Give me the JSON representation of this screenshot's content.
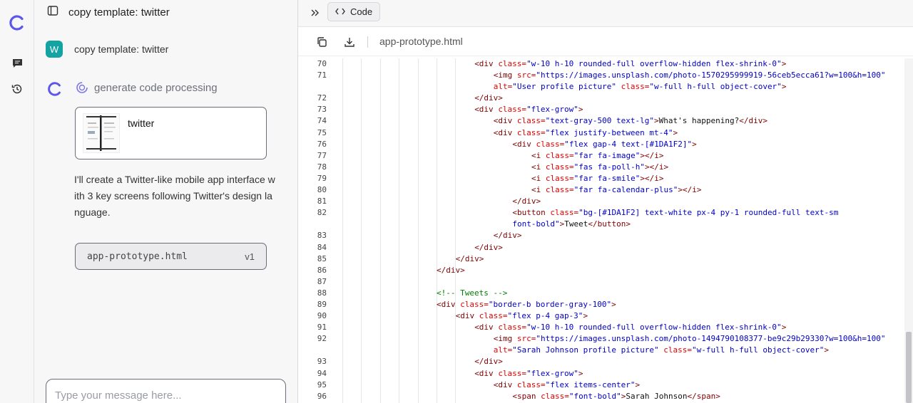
{
  "sidebar": {
    "icons": [
      "brand-logo-icon",
      "chat-icon",
      "history-icon"
    ]
  },
  "chat": {
    "header_title": "copy template: twitter",
    "user_avatar_letter": "W",
    "user_message": "copy template: twitter",
    "status_text": "generate code processing",
    "card_title": "twitter",
    "reply_text": "I'll create a Twitter-like mobile app interface with 3 key screens following Twitter's design language.",
    "file_chip": {
      "name": "app-prototype.html",
      "version": "v1"
    },
    "composer_placeholder": "Type your message here..."
  },
  "code_pane": {
    "tab_label": "Code",
    "filename": "app-prototype.html",
    "lines": [
      {
        "n": "70",
        "indent": 6,
        "html": "<span class=\"t-tag\">&lt;div</span> <span class=\"t-attr\">class=</span><span class=\"t-val\">\"w-10 h-10 rounded-full overflow-hidden flex-shrink-0\"</span><span class=\"t-tag\">&gt;</span>"
      },
      {
        "n": "71",
        "indent": 8,
        "html": "<span class=\"t-tag\">&lt;img</span> <span class=\"t-attr\">src=</span><span class=\"t-val\">\"https://images.unsplash.com/photo-1570295999919-56ceb5ecca61?w=100&amp;h=100\"</span>"
      },
      {
        "n": "",
        "indent": 8,
        "html": "<span class=\"t-attr\">alt=</span><span class=\"t-val\">\"User profile picture\"</span> <span class=\"t-attr\">class=</span><span class=\"t-val\">\"w-full h-full object-cover\"</span><span class=\"t-tag\">&gt;</span>"
      },
      {
        "n": "72",
        "indent": 6,
        "html": "<span class=\"t-tag\">&lt;/div&gt;</span>"
      },
      {
        "n": "73",
        "indent": 6,
        "html": "<span class=\"t-tag\">&lt;div</span> <span class=\"t-attr\">class=</span><span class=\"t-val\">\"flex-grow\"</span><span class=\"t-tag\">&gt;</span>"
      },
      {
        "n": "74",
        "indent": 8,
        "html": "<span class=\"t-tag\">&lt;div</span> <span class=\"t-attr\">class=</span><span class=\"t-val\">\"text-gray-500 text-lg\"</span><span class=\"t-tag\">&gt;</span><span class=\"t-text\">What's happening?</span><span class=\"t-tag\">&lt;/div&gt;</span>"
      },
      {
        "n": "75",
        "indent": 8,
        "html": "<span class=\"t-tag\">&lt;div</span> <span class=\"t-attr\">class=</span><span class=\"t-val\">\"flex justify-between mt-4\"</span><span class=\"t-tag\">&gt;</span>"
      },
      {
        "n": "76",
        "indent": 10,
        "html": "<span class=\"t-tag\">&lt;div</span> <span class=\"t-attr\">class=</span><span class=\"t-val\">\"flex gap-4 text-[#1DA1F2]\"</span><span class=\"t-tag\">&gt;</span>"
      },
      {
        "n": "77",
        "indent": 12,
        "html": "<span class=\"t-tag\">&lt;i</span> <span class=\"t-attr\">class=</span><span class=\"t-val\">\"far fa-image\"</span><span class=\"t-tag\">&gt;&lt;/i&gt;</span>"
      },
      {
        "n": "78",
        "indent": 12,
        "html": "<span class=\"t-tag\">&lt;i</span> <span class=\"t-attr\">class=</span><span class=\"t-val\">\"fas fa-poll-h\"</span><span class=\"t-tag\">&gt;&lt;/i&gt;</span>"
      },
      {
        "n": "79",
        "indent": 12,
        "html": "<span class=\"t-tag\">&lt;i</span> <span class=\"t-attr\">class=</span><span class=\"t-val\">\"far fa-smile\"</span><span class=\"t-tag\">&gt;&lt;/i&gt;</span>"
      },
      {
        "n": "80",
        "indent": 12,
        "html": "<span class=\"t-tag\">&lt;i</span> <span class=\"t-attr\">class=</span><span class=\"t-val\">\"far fa-calendar-plus\"</span><span class=\"t-tag\">&gt;&lt;/i&gt;</span>"
      },
      {
        "n": "81",
        "indent": 10,
        "html": "<span class=\"t-tag\">&lt;/div&gt;</span>"
      },
      {
        "n": "82",
        "indent": 10,
        "html": "<span class=\"t-tag\">&lt;button</span> <span class=\"t-attr\">class=</span><span class=\"t-val\">\"bg-[#1DA1F2] text-white px-4 py-1 rounded-full text-sm</span>"
      },
      {
        "n": "",
        "indent": 10,
        "html": "<span class=\"t-val\">font-bold\"</span><span class=\"t-tag\">&gt;</span><span class=\"t-text\">Tweet</span><span class=\"t-tag\">&lt;/button&gt;</span>"
      },
      {
        "n": "83",
        "indent": 8,
        "html": "<span class=\"t-tag\">&lt;/div&gt;</span>"
      },
      {
        "n": "84",
        "indent": 6,
        "html": "<span class=\"t-tag\">&lt;/div&gt;</span>"
      },
      {
        "n": "85",
        "indent": 4,
        "html": "<span class=\"t-tag\">&lt;/div&gt;</span>"
      },
      {
        "n": "86",
        "indent": 2,
        "html": "<span class=\"t-tag\">&lt;/div&gt;</span>"
      },
      {
        "n": "87",
        "indent": 0,
        "html": ""
      },
      {
        "n": "88",
        "indent": 2,
        "html": "<span class=\"t-com\">&lt;!-- Tweets --&gt;</span>"
      },
      {
        "n": "89",
        "indent": 2,
        "html": "<span class=\"t-tag\">&lt;div</span> <span class=\"t-attr\">class=</span><span class=\"t-val\">\"border-b border-gray-100\"</span><span class=\"t-tag\">&gt;</span>"
      },
      {
        "n": "90",
        "indent": 4,
        "html": "<span class=\"t-tag\">&lt;div</span> <span class=\"t-attr\">class=</span><span class=\"t-val\">\"flex p-4 gap-3\"</span><span class=\"t-tag\">&gt;</span>"
      },
      {
        "n": "91",
        "indent": 6,
        "html": "<span class=\"t-tag\">&lt;div</span> <span class=\"t-attr\">class=</span><span class=\"t-val\">\"w-10 h-10 rounded-full overflow-hidden flex-shrink-0\"</span><span class=\"t-tag\">&gt;</span>"
      },
      {
        "n": "92",
        "indent": 8,
        "html": "<span class=\"t-tag\">&lt;img</span> <span class=\"t-attr\">src=</span><span class=\"t-val\">\"https://images.unsplash.com/photo-1494790108377-be9c29b29330?w=100&amp;h=100\"</span>"
      },
      {
        "n": "",
        "indent": 8,
        "html": "<span class=\"t-attr\">alt=</span><span class=\"t-val\">\"Sarah Johnson profile picture\"</span> <span class=\"t-attr\">class=</span><span class=\"t-val\">\"w-full h-full object-cover\"</span><span class=\"t-tag\">&gt;</span>"
      },
      {
        "n": "93",
        "indent": 6,
        "html": "<span class=\"t-tag\">&lt;/div&gt;</span>"
      },
      {
        "n": "94",
        "indent": 6,
        "html": "<span class=\"t-tag\">&lt;div</span> <span class=\"t-attr\">class=</span><span class=\"t-val\">\"flex-grow\"</span><span class=\"t-tag\">&gt;</span>"
      },
      {
        "n": "95",
        "indent": 8,
        "html": "<span class=\"t-tag\">&lt;div</span> <span class=\"t-attr\">class=</span><span class=\"t-val\">\"flex items-center\"</span><span class=\"t-tag\">&gt;</span>"
      },
      {
        "n": "96",
        "indent": 10,
        "html": "<span class=\"t-tag\">&lt;span</span> <span class=\"t-attr\">class=</span><span class=\"t-val\">\"font-bold\"</span><span class=\"t-tag\">&gt;</span><span class=\"t-text\">Sarah Johnson</span><span class=\"t-tag\">&lt;/span&gt;</span>"
      }
    ]
  },
  "colors": {
    "brand": "#5b57e8",
    "avatar": "#14a3a3"
  }
}
